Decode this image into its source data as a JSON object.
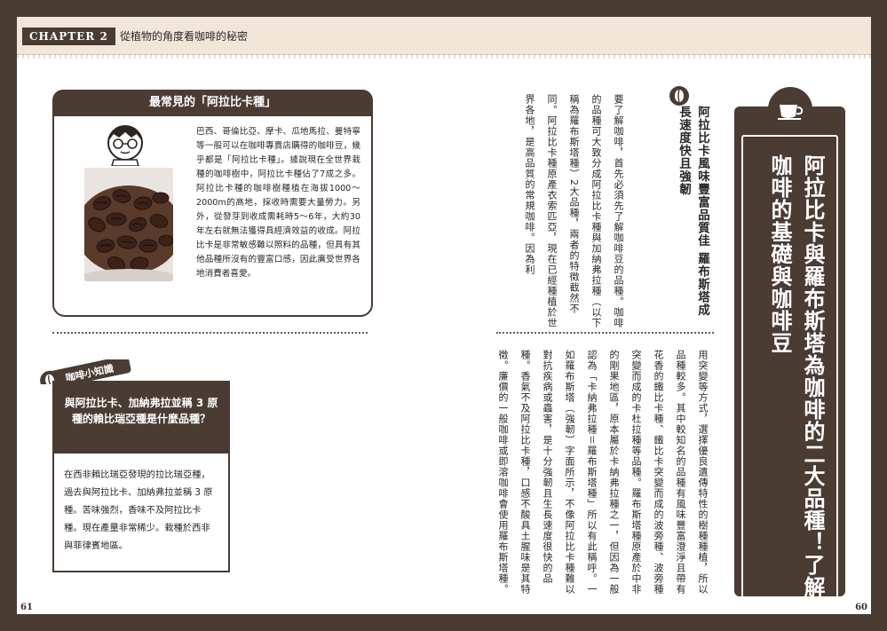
{
  "header": {
    "chapter_label": "CHAPTER 2",
    "chapter_title": "從植物的角度看咖啡的秘密"
  },
  "arabica_box": {
    "title": "最常見的「阿拉比卡種」",
    "body": "巴西、哥倫比亞、摩卡、瓜地馬拉、曼特寧等一般可以在咖啡專賣店購得的咖啡豆，幾乎都是「阿拉比卡種」。據說現在全世界栽種的咖啡樹中，阿拉比卡種佔了7成之多。阿拉比卡種的咖啡樹種植在海拔1000～2000m的高地，採收時需要大量勞力。另外，從發芽到收成需耗時5～6年，大約30年左右就無法獲得具經濟效益的收成。阿拉比卡是非常敏感難以照料的品種，但具有其他品種所沒有的豐富口感，因此廣受世界各地消費者喜愛。"
  },
  "trivia": {
    "tag": "咖啡小知識",
    "question": "與阿拉比卡、加納弗拉並稱 3 原種的賴比瑞亞種是什麼品種？",
    "answer": "在西非賴比瑞亞發現的拉比瑞亞種，過去與阿拉比卡、加納弗拉並稱 3 原種。苦味強烈，香味不及阿拉比卡種。現在產量非常稀少。栽種於西非與菲律賓地區。"
  },
  "main": {
    "title": "阿拉比卡與羅布斯塔為咖啡的二大品種！了解咖啡的基礎與咖啡豆",
    "subheading": "阿拉比卡風味豐富品質佳 羅布斯塔成長速度快且強韌",
    "body_top": "要了解咖啡，首先必須先了解咖啡豆的品種。咖啡的品種可大致分成阿拉比卡種與加納弗拉種（以下稱為羅布斯塔種）2大品種，兩者的特徵截然不同。阿拉比卡種原產衣索匹亞，現在已經種植於世界各地，是高品質的常規咖啡。因為利",
    "body_bottom": "用突變等方式，選擇優良遺傳特性的樹種種植，所以品種較多。其中較知名的品種有風味豐富澄淨且帶有花香的鐵比卡種、鐵比卡突變而成的波旁種、波旁種突變而成的卡杜拉種等品種。羅布斯塔種原產於中非的剛果地區，原本屬於卡納弗拉種之一，但因為一般認為「卡納弗拉種＝羅布斯塔種」所以有此稱呼。一如羅布斯塔（強韌）字面所示，不像阿拉比卡種難以對抗疾病或蟲害，是十分強韌且生長速度很快的品種。香氣不及阿拉比卡種，口感不酸具土腥味是其特徵。廉價的一般咖啡或即溶咖啡會使用羅布斯塔種。"
  },
  "page_numbers": {
    "left": "61",
    "right": "60"
  },
  "colors": {
    "frame": "#4a3b33",
    "header_bg": "#f1e6d8"
  }
}
